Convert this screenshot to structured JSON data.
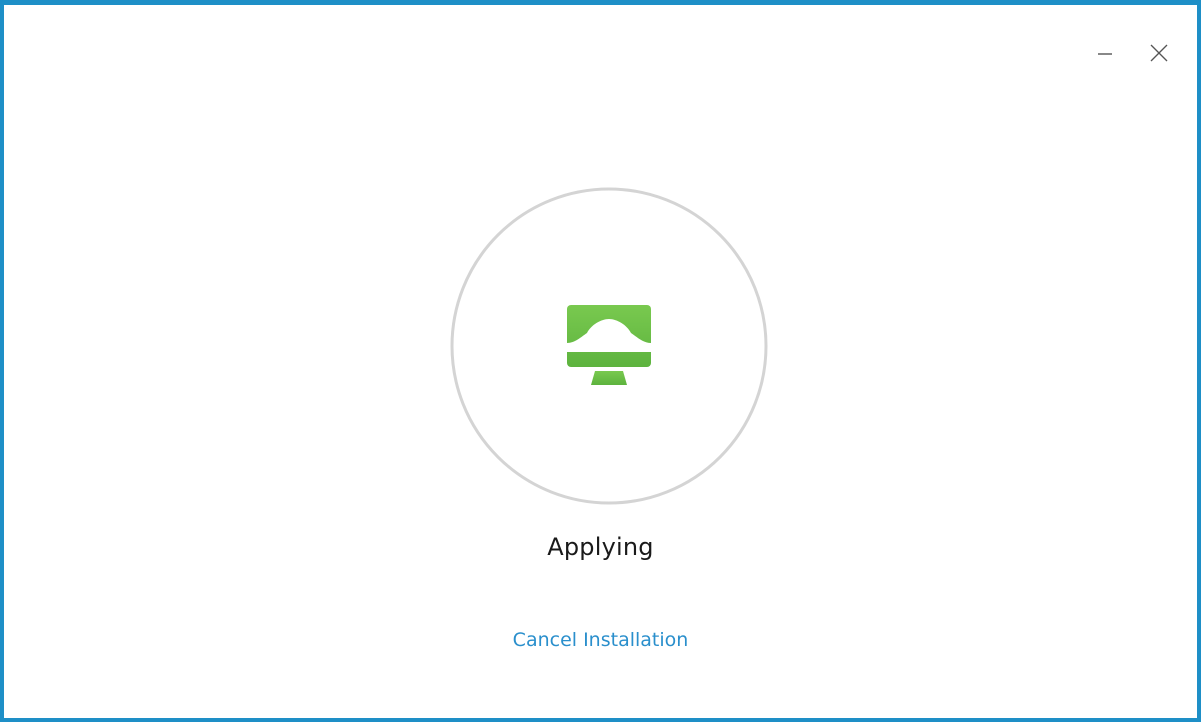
{
  "window": {
    "border_color": "#1e8fc7",
    "controls": [
      {
        "name": "minimize",
        "icon": "minimize-icon"
      },
      {
        "name": "close",
        "icon": "close-icon"
      }
    ]
  },
  "installer": {
    "icon": "monitor-cloud-icon",
    "icon_color": "#6cc04a",
    "ring_color": "#d4d4d4",
    "status_text": "Applying",
    "cancel_label": "Cancel Installation",
    "link_color": "#2a8fcc"
  }
}
